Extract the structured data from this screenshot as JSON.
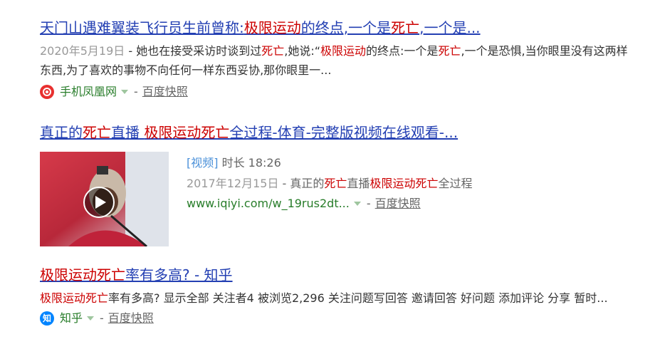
{
  "results": [
    {
      "title_parts": [
        "天门山遇难翼装飞行员生前曾称:",
        "极限运动",
        "的终点,一个是",
        "死亡",
        ",一个是..."
      ],
      "date": "2020年5月19日",
      "abstract_parts": [
        " - 她也在接受采访时谈到过",
        "死亡",
        ",她说:“",
        "极限运动",
        "的终点:一个是",
        "死亡",
        ",一个是恐惧,当你眼里没有这两样东西,为了喜欢的事物不向任何一样东西妥协,那你眼里一..."
      ],
      "source": "手机凤凰网",
      "dash": "-",
      "snapshot": "百度快照"
    },
    {
      "title_parts": [
        "真正的",
        "死亡",
        "直播 ",
        "极限运动死亡",
        "全过程-体育-完整版视频在线观看-..."
      ],
      "video_tag": "[视频]",
      "duration": "时长 18:26",
      "date": "2017年12月15日",
      "abstract_parts": [
        " - 真正的",
        "死亡",
        "直播",
        "极限运动死亡",
        "全过程"
      ],
      "source": "www.iqiyi.com/w_19rus2dt...",
      "dash": "-",
      "snapshot": "百度快照"
    },
    {
      "title_parts": [
        "极限运动死亡",
        "率有多高? - 知乎"
      ],
      "abstract_parts": [
        "极限运动死亡",
        "率有多高? 显示全部  关注者4 被浏览2,296 关注问题写回答 邀请回答 好问题 添加评论 分享 暂时..."
      ],
      "source_icon_char": "知",
      "source": "知乎",
      "dash": "-",
      "snapshot": "百度快照"
    }
  ],
  "colors": {
    "link": "#2440b3",
    "emphasis": "#c00000",
    "source": "#287d2a",
    "zhihu_blue": "#0084ff",
    "ifeng_red": "#e8302f"
  },
  "icons": {
    "ifeng": "phoenix-logo-icon",
    "zhihu": "zhihu-logo-icon",
    "play": "play-icon",
    "caret": "caret-down-icon"
  }
}
